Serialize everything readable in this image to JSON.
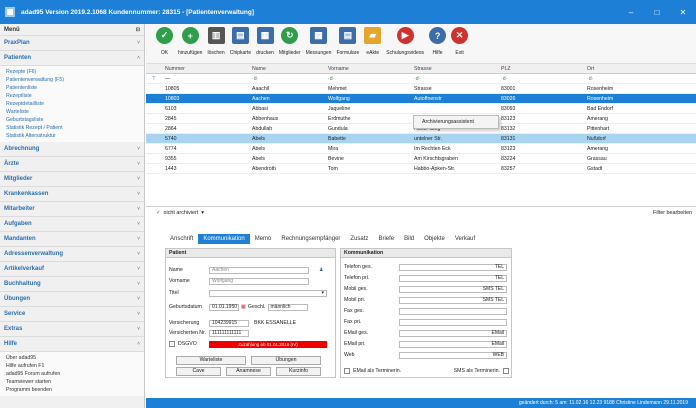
{
  "window": {
    "title": "adad95 Version 2019.2.1068 Kundennummer: 28315 - [Patientenverwaltung]"
  },
  "sidebar": {
    "header": "Menü",
    "sections": [
      {
        "label": "PraxPlan",
        "items": []
      },
      {
        "label": "Patienten",
        "expanded": true,
        "items": [
          "Rezepte (F6)",
          "Patientenverwaltung (F5)",
          "Patientenliste",
          "Rezeptliste",
          "Rezeptdetailliste",
          "Warteliste",
          "Geburtstagsliste",
          "Statistik Rezept / Patient",
          "Statistik Altersstruktur"
        ]
      },
      {
        "label": "Abrechnung",
        "items": []
      },
      {
        "label": "Ärzte",
        "items": []
      },
      {
        "label": "Mitglieder",
        "items": []
      },
      {
        "label": "Krankenkassen",
        "items": []
      },
      {
        "label": "Mitarbeiter",
        "items": []
      },
      {
        "label": "Aufgaben",
        "items": []
      },
      {
        "label": "Mandanten",
        "items": []
      },
      {
        "label": "Adressenverwaltung",
        "items": []
      },
      {
        "label": "Artikelverkauf",
        "items": []
      },
      {
        "label": "Buchhaltung",
        "items": []
      },
      {
        "label": "Übungen",
        "items": []
      },
      {
        "label": "Service",
        "items": []
      },
      {
        "label": "Extras",
        "items": []
      },
      {
        "label": "Hilfe",
        "expanded": true,
        "items": [
          "Über adad95",
          "Hilfe aufrufen F1",
          "adad95 Forum aufrufen",
          "Teamviewer starten",
          "Programm beenden"
        ]
      }
    ]
  },
  "toolbar": [
    {
      "label": "OK",
      "icon": "check-icon",
      "color": "#2e9e4a"
    },
    {
      "label": "hinzufügen",
      "icon": "plus-icon",
      "color": "#2e9e4a"
    },
    {
      "label": "löschen",
      "icon": "trash-icon",
      "color": "#555"
    },
    {
      "label": "Chipkarte",
      "icon": "card-icon",
      "color": "#3b6ea8"
    },
    {
      "label": "drucken",
      "icon": "printer-icon",
      "color": "#3b6ea8"
    },
    {
      "label": "Mitglieder",
      "icon": "refresh-icon",
      "color": "#2e9e4a"
    },
    {
      "label": "Messungen",
      "icon": "chart-icon",
      "color": "#3b6ea8"
    },
    {
      "label": "Formulare",
      "icon": "form-icon",
      "color": "#3b6ea8"
    },
    {
      "label": "eAkte",
      "icon": "folder-icon",
      "color": "#e4a72b"
    },
    {
      "label": "Schulungsvideos",
      "icon": "youtube-icon",
      "color": "#d0312d"
    },
    {
      "label": "Hilfe",
      "icon": "help-icon",
      "color": "#3b6ea8"
    },
    {
      "label": "Exit",
      "icon": "close-icon",
      "color": "#d0312d"
    }
  ],
  "grid": {
    "columns": [
      "Nummer",
      "Name",
      "Vorname",
      "Strasse",
      "PLZ",
      "Ort"
    ],
    "filter": [
      "",
      "",
      "",
      "",
      "",
      ""
    ],
    "rows": [
      [
        "10805",
        "Aaachil",
        "Mehmet",
        "Strasse",
        "83001",
        "Rosenheim"
      ],
      [
        "10803",
        "Aachen",
        "Wolfgang",
        "Autoffnenstr",
        "83026",
        "Rosenheim"
      ],
      [
        "6103",
        "Abbasi",
        "Jaqueline",
        "",
        "83093",
        "Bad Endorf"
      ],
      [
        "2845",
        "Abbenhaus",
        "Erdmuthe",
        "Venloer Str.",
        "83123",
        "Amerang"
      ],
      [
        "2864",
        "Abdullah",
        "Gundula",
        "Hoher Steg",
        "83132",
        "Pittenhart"
      ],
      [
        "5740",
        "Abels",
        "Babette",
        "untelner Str.",
        "83131",
        "Nußdorf"
      ],
      [
        "6774",
        "Abels",
        "Mira",
        "Im Rechten Eck",
        "83123",
        "Amerang"
      ],
      [
        "9355",
        "Abels",
        "Bevine",
        "Am Kirschtsgraben",
        "83224",
        "Grassau"
      ],
      [
        "1443",
        "Abendroth",
        "Tom",
        "Habbo-Apken-Str.",
        "83257",
        "Gstadt"
      ]
    ]
  },
  "context_menu": {
    "item": "Archivierungsassistent"
  },
  "filterbar": {
    "filter": "nicht archiviert",
    "edit": "Filter bearbeiten"
  },
  "tabs": [
    "Anschrift",
    "Kommunikation",
    "Memo",
    "Rechnungsempfänger",
    "Zusatz",
    "Briefe",
    "Bild",
    "Objekte",
    "Verkauf"
  ],
  "patient": {
    "title": "Patient",
    "name_label": "Name",
    "name": "Aachen",
    "vorname_label": "Vorname",
    "vorname": "Wolfgang",
    "titel_label": "Titel",
    "geb_label": "Geburtsdatum",
    "geb": "01.01.1950",
    "geschl_label": "Geschl.",
    "geschl": "männlich",
    "vers_label": "Versicherung",
    "vers": "104239915",
    "vers_name": "BKK ESSANELLE",
    "versnr_label": "Versicherten Nr.",
    "versnr": "111111111111",
    "dsgvo": "DSGVO",
    "warning": "Zuzahlung ab 01.01.2018 (IV)",
    "buttons": [
      "Warteliste",
      "Übungen",
      "Cave",
      "Anamnese",
      "Kurzinfo"
    ]
  },
  "komm": {
    "title": "Kommunikation",
    "fields": [
      {
        "label": "Telefon ges.",
        "tag": "TEL"
      },
      {
        "label": "Telefon pri.",
        "tag": "TEL"
      },
      {
        "label": "Mobil ges.",
        "tag": "SMS TEL"
      },
      {
        "label": "Mobil pri.",
        "tag": "SMS TEL"
      },
      {
        "label": "Fax ges.",
        "tag": ""
      },
      {
        "label": "Fax pri.",
        "tag": ""
      },
      {
        "label": "EMail ges.",
        "tag": "EMail"
      },
      {
        "label": "EMail pri.",
        "tag": "EMail"
      },
      {
        "label": "Web",
        "tag": "WEB"
      }
    ],
    "email_termin": "EMail als Terminerin.",
    "sms_termin": "SMS als Terminerin."
  },
  "status": "geändert durch: 5 am: 11.02.16 12.23   9188   Christine Lindemann   29.11.2019"
}
